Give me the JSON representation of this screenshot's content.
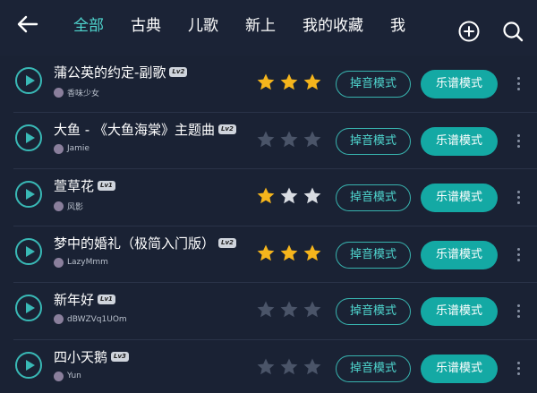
{
  "header": {
    "tabs": [
      {
        "label": "全部",
        "active": true
      },
      {
        "label": "古典",
        "active": false
      },
      {
        "label": "儿歌",
        "active": false
      },
      {
        "label": "新上",
        "active": false
      },
      {
        "label": "我的收藏",
        "active": false
      },
      {
        "label": "我",
        "active": false
      }
    ],
    "icons": [
      "back-arrow-icon",
      "add-icon",
      "search-icon"
    ]
  },
  "songs": [
    {
      "title": "蒲公英的约定-副歌",
      "level": "Lv2",
      "author": "香味少女",
      "stars": 3,
      "tap_mode_label": "掉音模式",
      "sheet_mode_label": "乐谱模式"
    },
    {
      "title": "大鱼 - 《大鱼海棠》主题曲",
      "level": "Lv2",
      "author": "Jamie",
      "stars": 0,
      "tap_mode_label": "掉音模式",
      "sheet_mode_label": "乐谱模式"
    },
    {
      "title": "萱草花",
      "level": "Lv1",
      "author": "风影",
      "stars": 1,
      "tap_mode_label": "掉音模式",
      "sheet_mode_label": "乐谱模式"
    },
    {
      "title": "梦中的婚礼（极简入门版）",
      "level": "Lv2",
      "author": "LazyMmm",
      "stars": 3,
      "tap_mode_label": "掉音模式",
      "sheet_mode_label": "乐谱模式"
    },
    {
      "title": "新年好",
      "level": "Lv1",
      "author": "dBWZVq1UOm",
      "stars": 0,
      "tap_mode_label": "掉音模式",
      "sheet_mode_label": "乐谱模式"
    },
    {
      "title": "四小天鹅",
      "level": "Lv3",
      "author": "Yun",
      "stars": 0,
      "tap_mode_label": "掉音模式",
      "sheet_mode_label": "乐谱模式"
    }
  ],
  "colors": {
    "accent": "#4fd6cf",
    "button_fill": "#14a9a4",
    "star_gold": "#f5b51c",
    "star_silver": "#d9dde3",
    "star_empty": "#4a5468",
    "background": "#1a2234"
  }
}
